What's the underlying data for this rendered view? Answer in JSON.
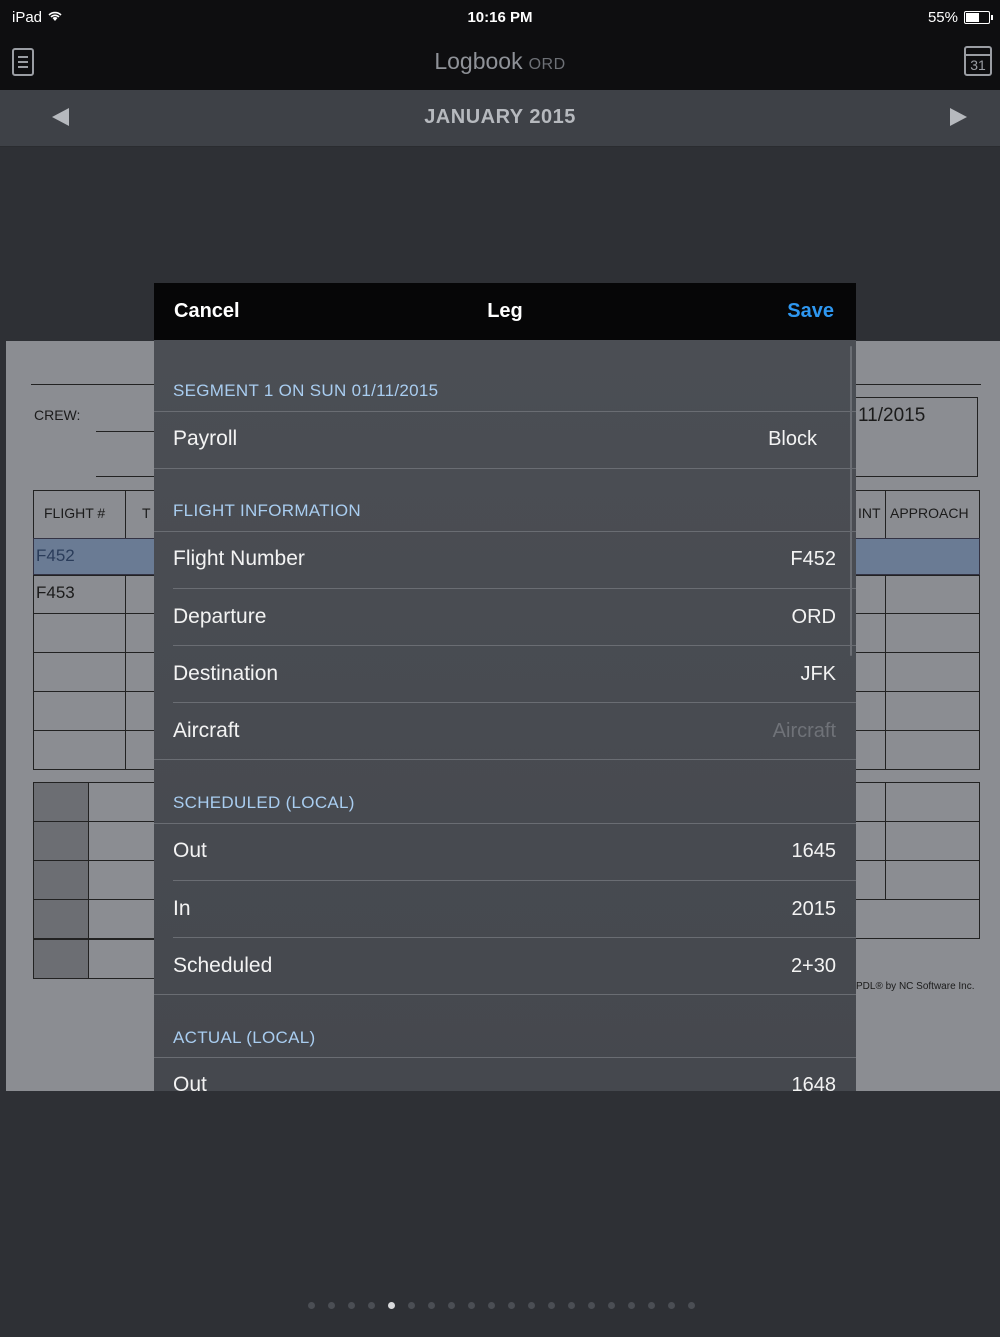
{
  "status_bar": {
    "device": "iPad",
    "time": "10:16 PM",
    "battery": "55%"
  },
  "nav": {
    "title": "Logbook",
    "subtitle": "ORD",
    "calendar_day": "31"
  },
  "month_bar": {
    "month": "JANUARY 2015"
  },
  "form": {
    "crew_label": "CREW:",
    "date_partial": "11/2015",
    "columns": [
      "FLIGHT #",
      "T",
      "INT",
      "APPROACH"
    ],
    "flights": [
      "F452",
      "F453"
    ],
    "credit": "PDL® by NC Software Inc."
  },
  "modal": {
    "cancel": "Cancel",
    "title": "Leg",
    "save": "Save",
    "segment_header": "SEGMENT 1 ON SUN 01/11/2015",
    "payroll": {
      "label": "Payroll",
      "value": "Block"
    },
    "flight_info_header": "FLIGHT INFORMATION",
    "flight_number": {
      "label": "Flight Number",
      "value": "F452"
    },
    "departure": {
      "label": "Departure",
      "value": "ORD"
    },
    "destination": {
      "label": "Destination",
      "value": "JFK"
    },
    "aircraft": {
      "label": "Aircraft",
      "placeholder": "Aircraft"
    },
    "scheduled_header": "SCHEDULED (LOCAL)",
    "sched_out": {
      "label": "Out",
      "value": "1645"
    },
    "sched_in": {
      "label": "In",
      "value": "2015"
    },
    "scheduled": {
      "label": "Scheduled",
      "value": "2+30"
    },
    "actual_header": "ACTUAL (LOCAL)",
    "actual_out": {
      "label": "Out",
      "value": "1648"
    }
  },
  "colors": {
    "accent": "#2e97f0",
    "section_header": "#a9cdf0"
  }
}
